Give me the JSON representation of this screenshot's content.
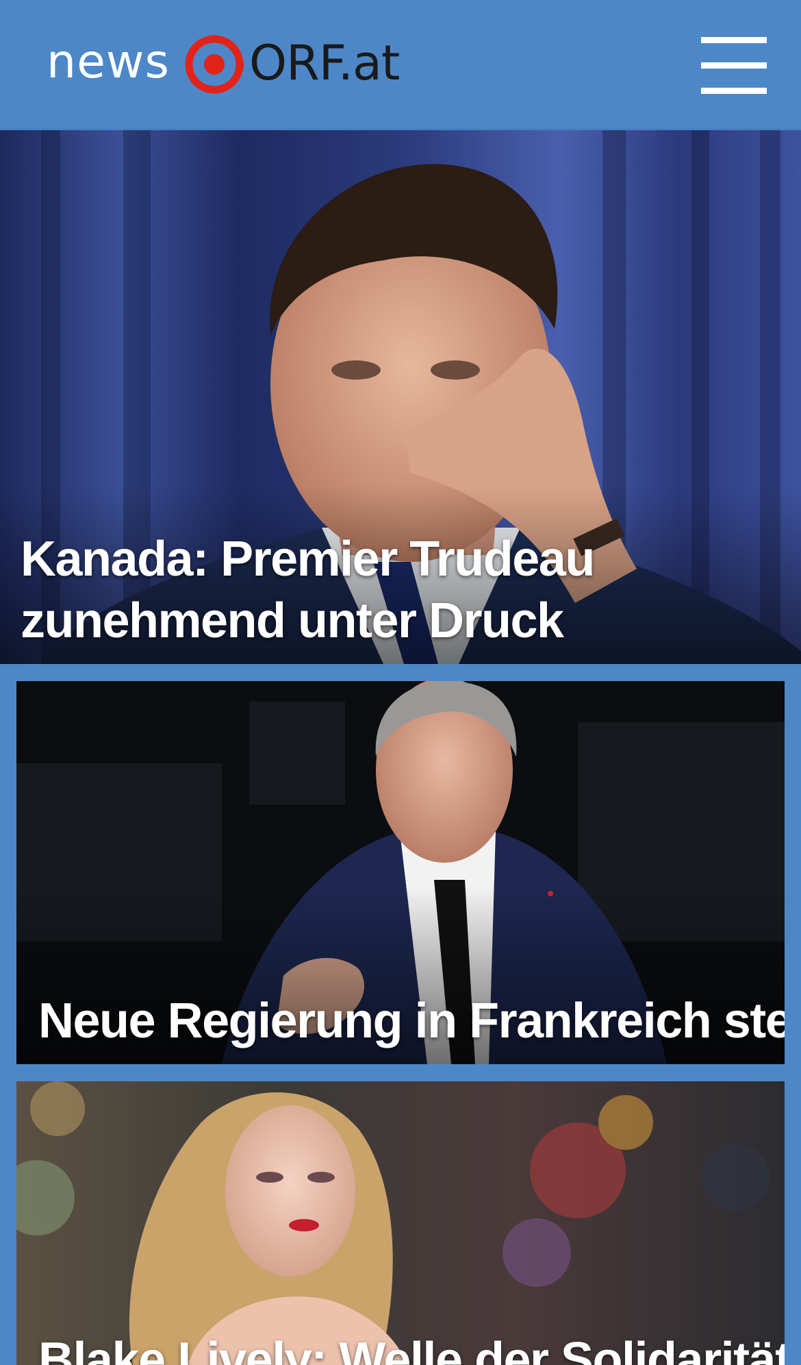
{
  "header": {
    "logo_news": "news",
    "logo_orf": "ORF.at",
    "logo_icon": "orf-eye-icon",
    "menu_icon": "hamburger-menu-icon",
    "colors": {
      "header_bg": "#4d87c8",
      "logo_red": "#e2231a",
      "logo_dark": "#1a1a1a"
    }
  },
  "stories": [
    {
      "title": "Kanada: Premier Trudeau zunehmend unter Druck"
    },
    {
      "title": "Neue Regierung in Frankreich steht"
    },
    {
      "title": "Blake Lively: Welle der Solidarität"
    }
  ]
}
